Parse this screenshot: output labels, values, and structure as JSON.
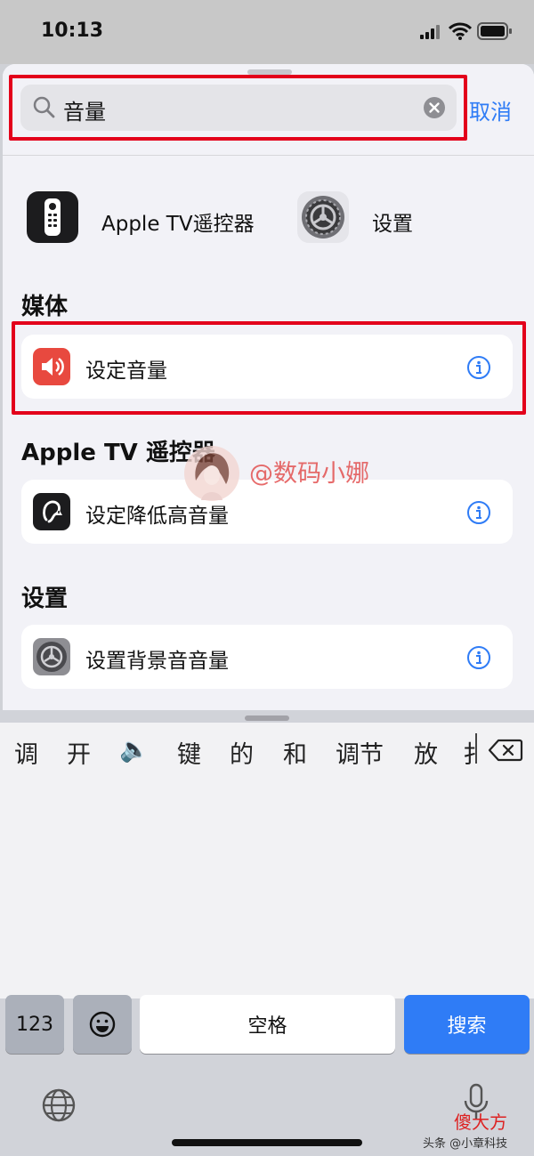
{
  "status": {
    "time": "10:13"
  },
  "search": {
    "query": "音量",
    "cancel_label": "取消"
  },
  "apps": [
    {
      "label": "Apple TV遥控器",
      "icon": "tv-remote-icon"
    },
    {
      "label": "设置",
      "icon": "settings-gear-icon"
    }
  ],
  "sections": [
    {
      "title": "媒体",
      "items": [
        {
          "label": "设定音量",
          "icon": "speaker-volume-icon",
          "color": "#e8493f"
        }
      ]
    },
    {
      "title": "Apple TV 遥控器",
      "items": [
        {
          "label": "设定降低高音量",
          "icon": "ear-warning-icon",
          "color": "#1c1c1e"
        }
      ]
    },
    {
      "title": "设置",
      "items": [
        {
          "label": "设置背景音音量",
          "icon": "settings-gear-icon",
          "color": "#8e8e93"
        }
      ]
    }
  ],
  "watermark": {
    "text": "@数码小娜"
  },
  "keyboard": {
    "candidates": [
      "调",
      "开",
      "🔈",
      "键",
      "的",
      "和",
      "调节",
      "放",
      "扌"
    ],
    "numbers_label": "123",
    "space_label": "空格",
    "search_label": "搜索"
  },
  "branding": {
    "logo_text": "傻大方",
    "credit": "头条 @小章科技"
  },
  "colors": {
    "accent": "#2f7cf6",
    "highlight_box": "#e3001b"
  }
}
